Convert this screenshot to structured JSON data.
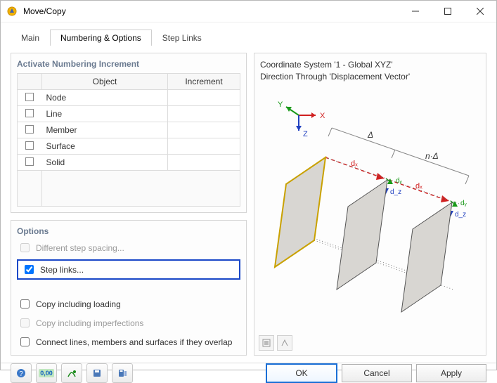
{
  "window": {
    "title": "Move/Copy"
  },
  "tabs": [
    "Main",
    "Numbering & Options",
    "Step Links"
  ],
  "active_tab": 1,
  "numbering": {
    "panel_title": "Activate Numbering Increment",
    "columns": [
      "Object",
      "Increment"
    ],
    "rows": [
      {
        "label": "Node",
        "checked": false,
        "increment": ""
      },
      {
        "label": "Line",
        "checked": false,
        "increment": ""
      },
      {
        "label": "Member",
        "checked": false,
        "increment": ""
      },
      {
        "label": "Surface",
        "checked": false,
        "increment": ""
      },
      {
        "label": "Solid",
        "checked": false,
        "increment": ""
      }
    ]
  },
  "options": {
    "panel_title": "Options",
    "items": [
      {
        "label": "Different step spacing...",
        "checked": false,
        "enabled": false,
        "highlight": false
      },
      {
        "label": "Step links...",
        "checked": true,
        "enabled": true,
        "highlight": true
      },
      {
        "label": "Copy including loading",
        "checked": false,
        "enabled": true,
        "highlight": false
      },
      {
        "label": "Copy including imperfections",
        "checked": false,
        "enabled": false,
        "highlight": false
      },
      {
        "label": "Connect lines, members and surfaces if they overlap",
        "checked": false,
        "enabled": true,
        "highlight": false
      }
    ]
  },
  "coord": {
    "line1": "Coordinate System '1 - Global XYZ'",
    "line2": "Direction Through 'Displacement Vector'"
  },
  "diagram": {
    "axis_x": "X",
    "axis_y": "Y",
    "axis_z": "Z",
    "delta": "Δ",
    "ndelta": "n·Δ",
    "dx": "dₓ",
    "dy": "dᵧ",
    "dz": "d_z"
  },
  "buttons": {
    "ok": "OK",
    "cancel": "Cancel",
    "apply": "Apply"
  },
  "tool_icons": [
    "help",
    "precision",
    "transform",
    "save-settings",
    "settings-list"
  ]
}
